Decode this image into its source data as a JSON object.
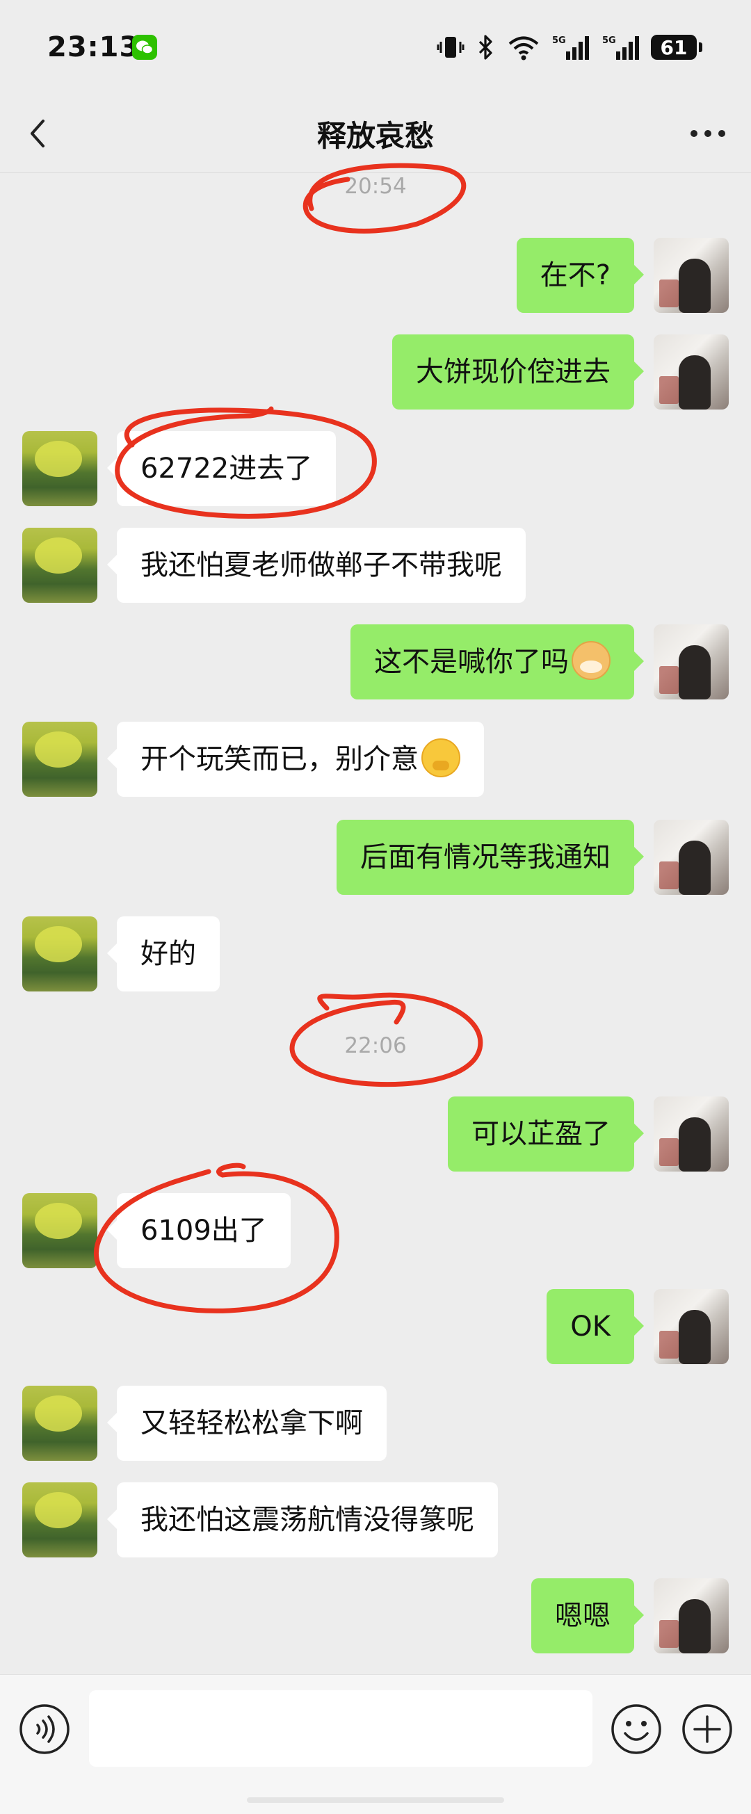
{
  "status_bar": {
    "time": "23:13",
    "battery": "61"
  },
  "header": {
    "title": "释放哀愁"
  },
  "messages": [
    {
      "type": "time",
      "text": "20:54"
    },
    {
      "side": "right",
      "text": "在不?"
    },
    {
      "side": "right",
      "text": "大饼现价倥进去"
    },
    {
      "side": "left",
      "text": "62722进去了"
    },
    {
      "side": "left",
      "text": "我还怕夏老师做郸子不带我呢"
    },
    {
      "side": "right",
      "text": "这不是喊你了吗",
      "emoji": "doge-emoji"
    },
    {
      "side": "left",
      "text": "开个玩笑而已，别介意",
      "emoji": "thinking-emoji"
    },
    {
      "side": "right",
      "text": "后面有情况等我通知"
    },
    {
      "side": "left",
      "text": "好的"
    },
    {
      "type": "time",
      "text": "22:06"
    },
    {
      "side": "right",
      "text": "可以芷盈了"
    },
    {
      "side": "left",
      "text": "6109出了"
    },
    {
      "side": "right",
      "text": "OK"
    },
    {
      "side": "left",
      "text": "又轻轻松松拿下啊"
    },
    {
      "side": "left",
      "text": "我还怕这震荡航情没得篆呢"
    },
    {
      "side": "right",
      "text": "嗯嗯"
    }
  ],
  "input": {
    "value": ""
  },
  "colors": {
    "sent_bubble": "#95ec69",
    "received_bubble": "#ffffff",
    "background": "#ededed",
    "annotation": "#e8321e"
  },
  "icons": [
    "back-icon",
    "more-icon",
    "voice-icon",
    "emoji-icon",
    "plus-icon",
    "wechat-icon",
    "vibrate-icon",
    "bluetooth-icon",
    "wifi-icon",
    "signal-icon"
  ]
}
